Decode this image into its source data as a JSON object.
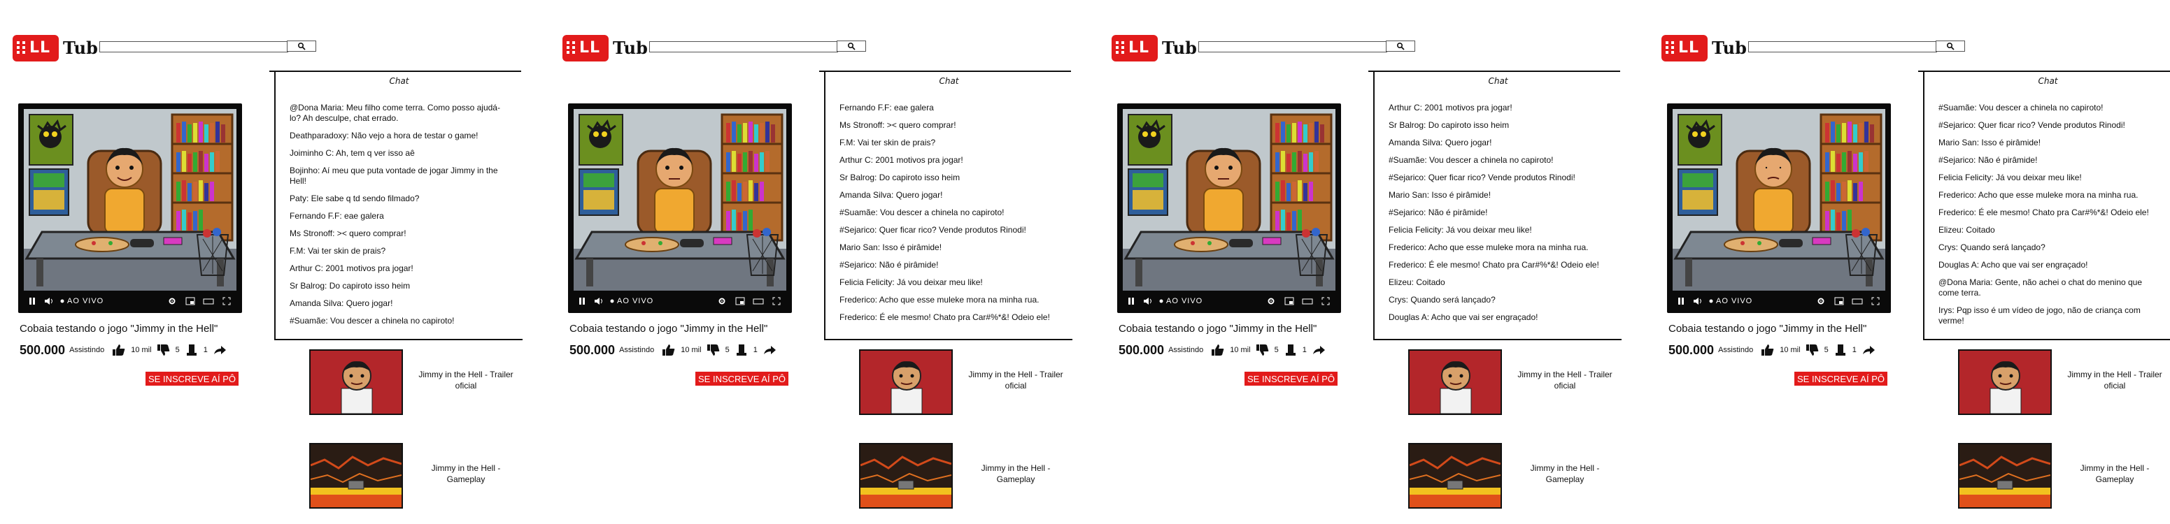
{
  "header": {
    "logo_mark": "LL",
    "logo_word": "Tub",
    "search_value": "",
    "search_button_icon": "search-icon"
  },
  "chat": {
    "title": "Chat"
  },
  "video": {
    "title": "Cobaia testando o jogo \"Jimmy in the Hell\"",
    "live_label": "AO VIVO",
    "viewers": "500.000",
    "viewers_label": "Assistindo",
    "likes": "10 mil",
    "dislikes": "5",
    "extra_count": "1",
    "subscribe_label": "SE INSCREVE AÍ PÔ"
  },
  "recommended": [
    {
      "title": "Jimmy in the Hell - Trailer oficial",
      "thumb": "trailer"
    },
    {
      "title": "Jimmy in the Hell - Gameplay",
      "thumb": "gameplay"
    }
  ],
  "panels": [
    {
      "chat_messages": [
        "@Dona Maria: Meu filho come terra. Como posso ajudá-lo? Ah desculpe, chat errado.",
        "Deathparadoxy: Não vejo a hora de testar o game!",
        "Joiminho C: Ah, tem q ver isso aê",
        "Bojinho: Aí meu que puta vontade de jogar Jimmy in the Hell!",
        "Paty: Ele sabe q td sendo filmado?",
        "Fernando F.F: eae galera",
        "Ms Stronoff: >< quero comprar!",
        "F.M: Vai ter skin de prais?",
        "Arthur C: 2001 motivos pra jogar!",
        "Sr Balrog: Do capiroto isso heim",
        "Amanda Silva: Quero jogar!",
        "#Suamãe: Vou descer a chinela no capiroto!"
      ],
      "character_mood": "smile"
    },
    {
      "chat_messages": [
        "Fernando F.F: eae galera",
        "Ms Stronoff: >< quero comprar!",
        "F.M: Vai ter skin de prais?",
        "Arthur C: 2001 motivos pra jogar!",
        "Sr Balrog: Do capiroto isso heim",
        "Amanda Silva: Quero jogar!",
        "#Suamãe: Vou descer a chinela no capiroto!",
        "#Sejarico: Quer ficar rico? Vende produtos Rinodi!",
        "Mario San: Isso é pirâmide!",
        "#Sejarico: Não é pirâmide!",
        "Felicia Felicity: Já vou deixar meu like!",
        "Frederico: Acho que esse muleke mora na minha rua.",
        "Frederico: É ele mesmo! Chato pra Car#%*&! Odeio ele!"
      ],
      "character_mood": "neutral"
    },
    {
      "chat_messages": [
        "Arthur C: 2001 motivos pra jogar!",
        "Sr Balrog: Do capiroto isso heim",
        "Amanda Silva: Quero jogar!",
        "#Suamãe: Vou descer a chinela no capiroto!",
        "#Sejarico: Quer ficar rico? Vende produtos Rinodi!",
        "Mario San: Isso é pirâmide!",
        "#Sejarico: Não é pirâmide!",
        "Felicia Felicity: Já vou deixar meu like!",
        "Frederico: Acho que esse muleke mora na minha rua.",
        "Frederico: É ele mesmo! Chato pra Car#%*&! Odeio ele!",
        "Elizeu: Coitado",
        "Crys: Quando será lançado?",
        "Douglas A: Acho que vai ser engraçado!"
      ],
      "character_mood": "neutral"
    },
    {
      "chat_messages": [
        "#Suamãe: Vou descer a chinela no capiroto!",
        "#Sejarico: Quer ficar rico? Vende produtos Rinodi!",
        "Mario San: Isso é pirâmide!",
        "#Sejarico: Não é pirâmide!",
        "Felicia Felicity: Já vou deixar meu like!",
        "Frederico: Acho que esse muleke mora na minha rua.",
        "Frederico: É ele mesmo! Chato pra Car#%*&! Odeio ele!",
        "Elizeu: Coitado",
        "Crys: Quando será lançado?",
        "Douglas A: Acho que vai ser engraçado!",
        "@Dona Maria: Gente, não achei o chat do menino que come terra.",
        "Irys: Pqp isso é um vídeo de jogo, não de criança com verme!"
      ],
      "character_mood": "sleepy"
    }
  ],
  "colors": {
    "brand_red": "#e21b1b",
    "ink": "#111111",
    "video_bg": "#0a0a0a"
  }
}
